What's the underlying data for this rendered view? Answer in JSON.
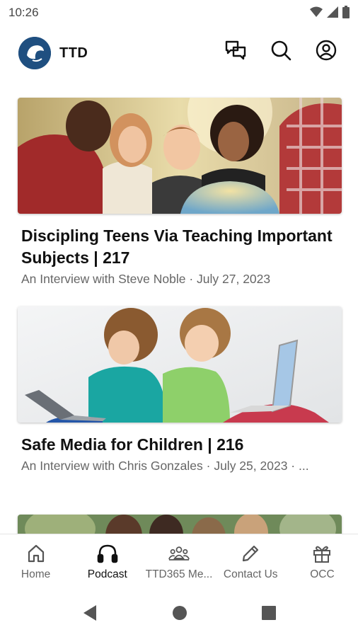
{
  "status": {
    "time": "10:26"
  },
  "header": {
    "app_title": "TTD"
  },
  "feed": {
    "episodes": [
      {
        "title": "Discipling Teens Via Teaching Important Subjects | 217",
        "subtitle": "An Interview with Steve Noble · July 27, 2023"
      },
      {
        "title": "Safe Media for Children | 216",
        "subtitle": "An Interview with Chris Gonzales · July 25, 2023 · ..."
      }
    ]
  },
  "bottom_nav": {
    "items": [
      {
        "label": "Home",
        "icon": "home-icon"
      },
      {
        "label": "Podcast",
        "icon": "headphones-icon",
        "active": true
      },
      {
        "label": "TTD365 Me...",
        "icon": "group-icon"
      },
      {
        "label": "Contact Us",
        "icon": "pencil-icon"
      },
      {
        "label": "OCC",
        "icon": "gift-icon"
      }
    ]
  }
}
